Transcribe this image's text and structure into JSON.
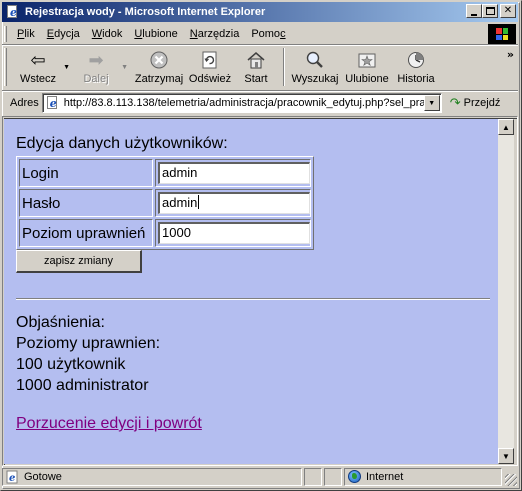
{
  "window": {
    "title": "Rejestracja wody - Microsoft Internet Explorer"
  },
  "menu": {
    "items": [
      {
        "first": "P",
        "rest": "lik"
      },
      {
        "first": "E",
        "rest": "dycja"
      },
      {
        "first": "W",
        "rest": "idok"
      },
      {
        "first": "U",
        "rest": "lubione"
      },
      {
        "first": "N",
        "rest": "arzędzia"
      },
      {
        "first": "Pomo",
        "rest": "c"
      }
    ]
  },
  "toolbar": {
    "back": "Wstecz",
    "forward": "Dalej",
    "stop": "Zatrzymaj",
    "refresh": "Odśwież",
    "home": "Start",
    "search": "Wyszukaj",
    "favorites": "Ulubione",
    "history": "Historia"
  },
  "address": {
    "label": "Adres",
    "url": "http://83.8.113.138/telemetria/administracja/pracownik_edytuj.php?sel_pra",
    "go": "Przejdź"
  },
  "page": {
    "heading": "Edycja danych użytkowników:",
    "fields": [
      {
        "label": "Login",
        "value": "admin"
      },
      {
        "label": "Hasło",
        "value": "admin"
      },
      {
        "label": "Poziom uprawnień",
        "value": "1000"
      }
    ],
    "save_button": "zapisz zmiany",
    "explain_title": "Objaśnienia:",
    "levels_title": "Poziomy uprawnien:",
    "level_user": "100 użytkownik",
    "level_admin": "1000 administrator",
    "back_link": "Porzucenie edycji i powrót"
  },
  "status": {
    "text": "Gotowe",
    "zone": "Internet"
  }
}
